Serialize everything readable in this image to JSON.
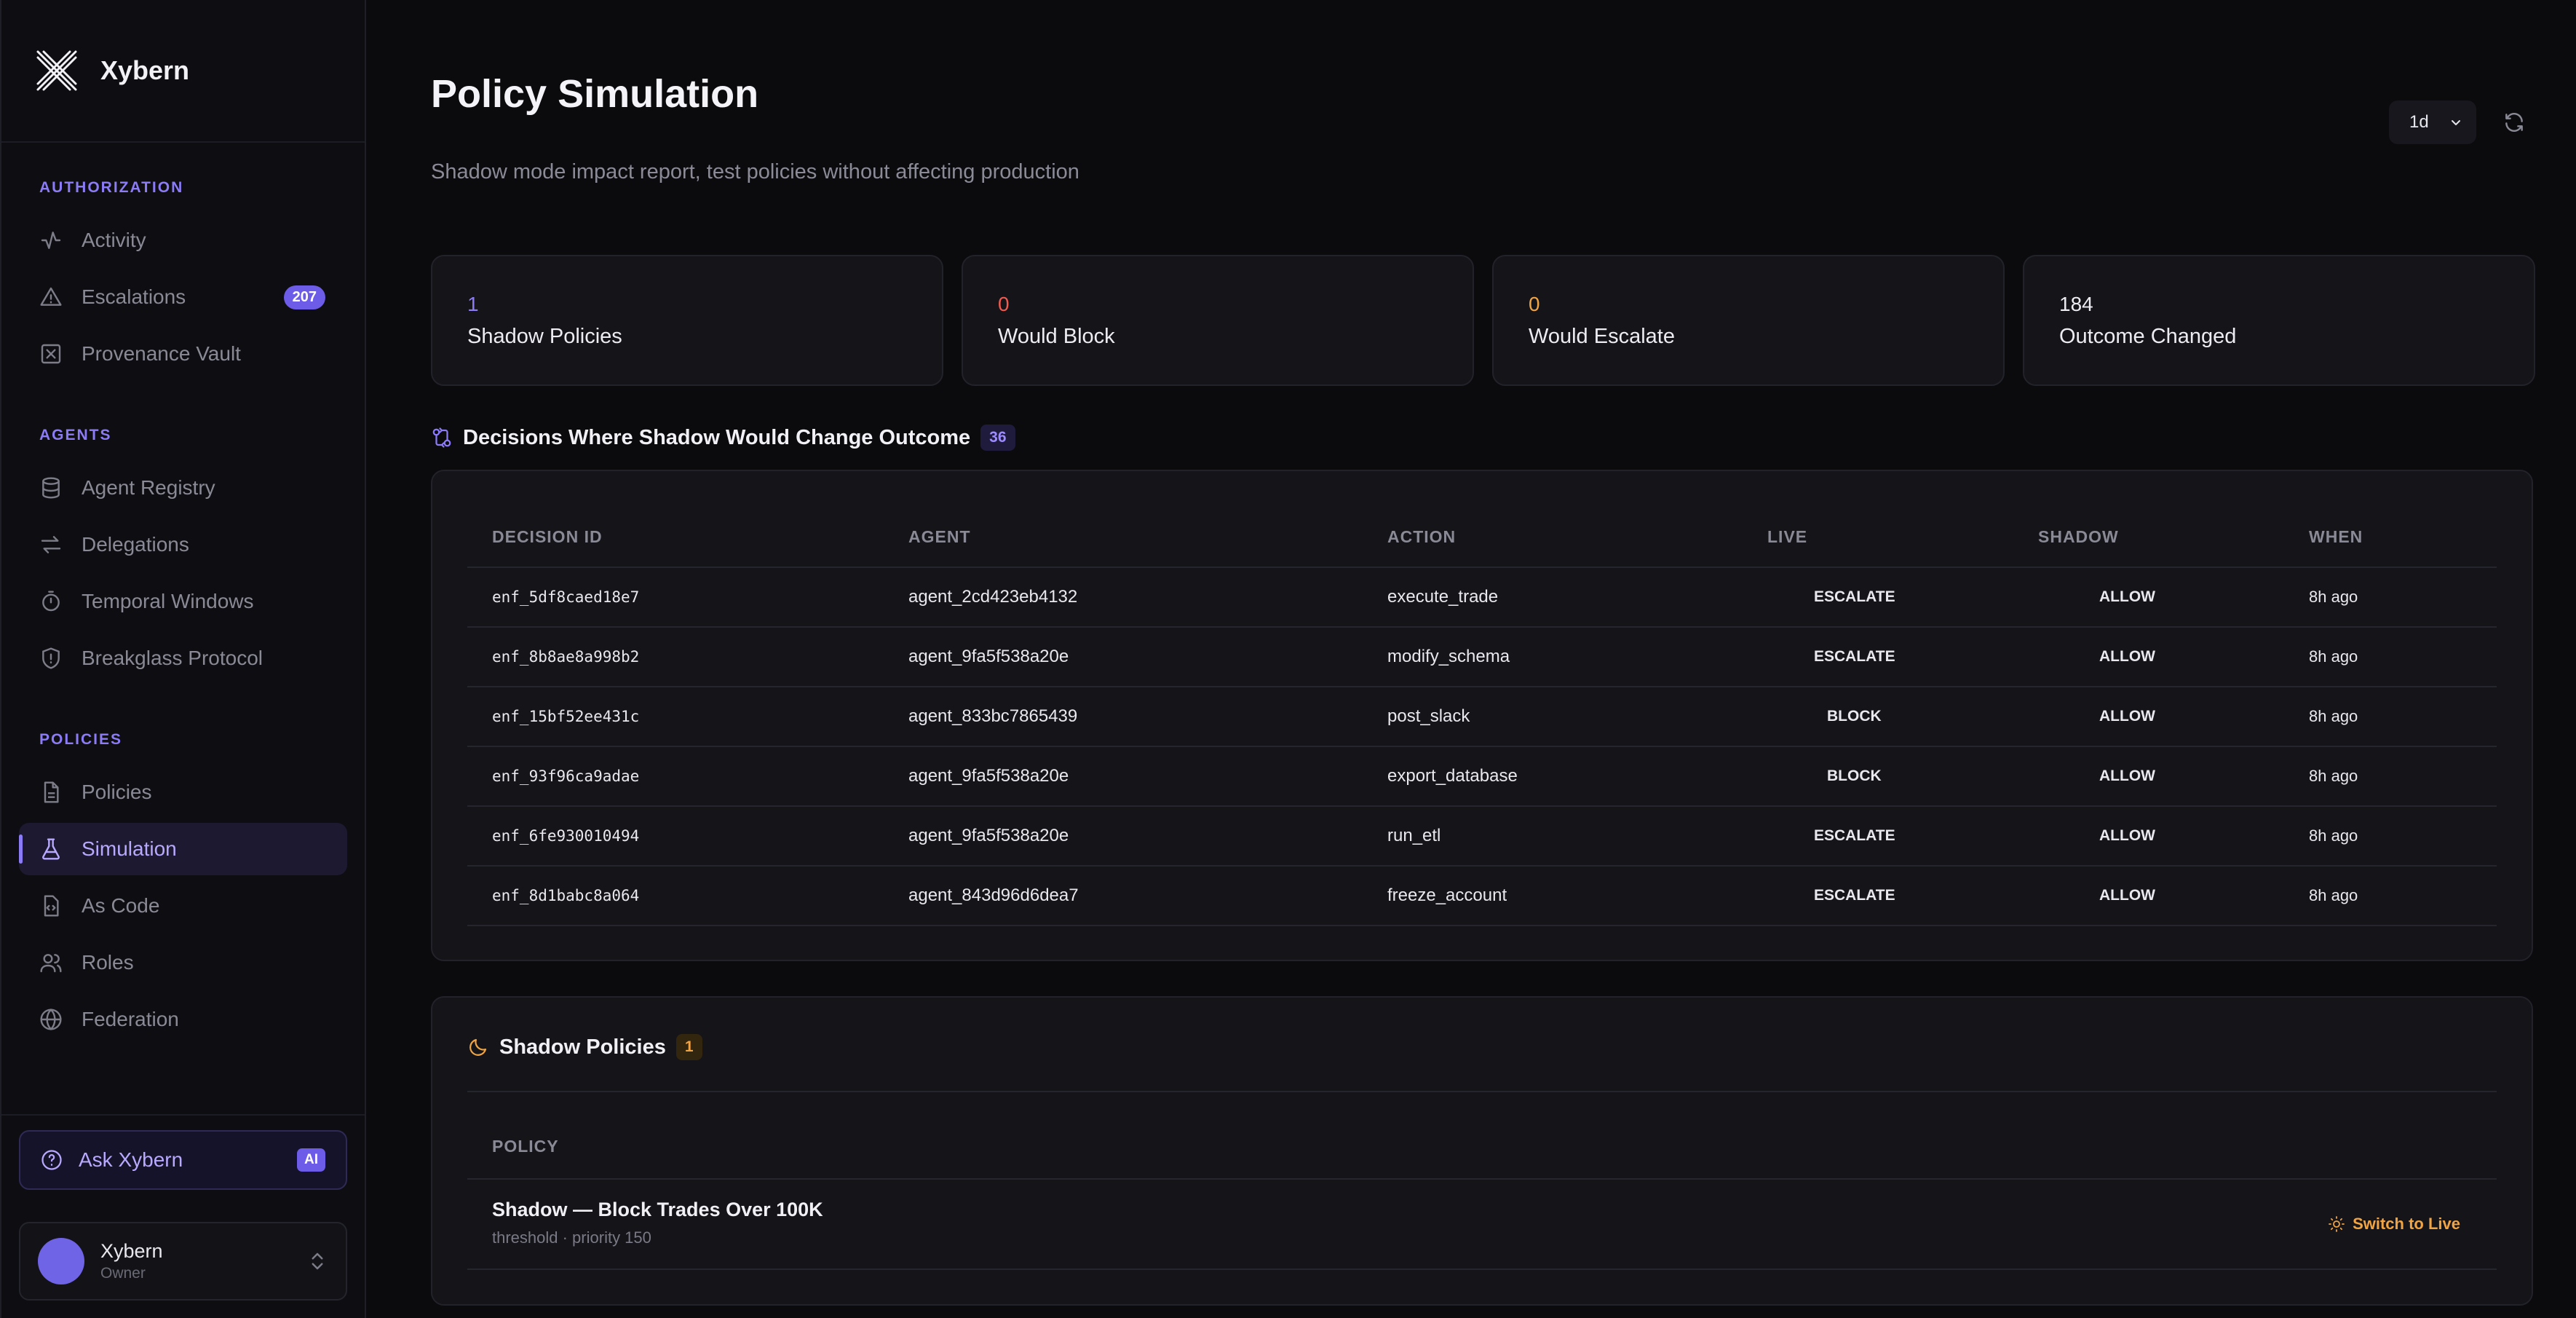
{
  "brand": {
    "name": "Xybern"
  },
  "sidebar": {
    "sections": [
      {
        "label": "AUTHORIZATION",
        "items": [
          {
            "label": "Activity",
            "icon": "activity-icon"
          },
          {
            "label": "Escalations",
            "icon": "warning-triangle-icon",
            "badge": "207"
          },
          {
            "label": "Provenance Vault",
            "icon": "vault-icon"
          }
        ]
      },
      {
        "label": "AGENTS",
        "items": [
          {
            "label": "Agent Registry",
            "icon": "database-icon"
          },
          {
            "label": "Delegations",
            "icon": "arrows-exchange-icon"
          },
          {
            "label": "Temporal Windows",
            "icon": "timer-icon"
          },
          {
            "label": "Breakglass Protocol",
            "icon": "shield-icon"
          }
        ]
      },
      {
        "label": "POLICIES",
        "items": [
          {
            "label": "Policies",
            "icon": "document-icon"
          },
          {
            "label": "Simulation",
            "icon": "flask-icon",
            "active": true
          },
          {
            "label": "As Code",
            "icon": "code-file-icon"
          },
          {
            "label": "Roles",
            "icon": "users-icon"
          },
          {
            "label": "Federation",
            "icon": "globe-icon"
          }
        ]
      }
    ],
    "ask": {
      "label": "Ask Xybern",
      "badge": "AI"
    },
    "user": {
      "name": "Xybern",
      "role": "Owner"
    }
  },
  "header": {
    "title": "Policy Simulation",
    "subtitle": "Shadow mode impact report, test policies without affecting production",
    "range": "1d"
  },
  "stats": [
    {
      "value": "1",
      "label": "Shadow Policies",
      "color": "#8b7cf6"
    },
    {
      "value": "0",
      "label": "Would Block",
      "color": "#f05a4f"
    },
    {
      "value": "0",
      "label": "Would Escalate",
      "color": "#f0a443"
    },
    {
      "value": "184",
      "label": "Outcome Changed",
      "color": "#ececf2"
    }
  ],
  "decisions": {
    "title": "Decisions Where Shadow Would Change Outcome",
    "count": "36",
    "columns": [
      "DECISION ID",
      "AGENT",
      "ACTION",
      "LIVE",
      "SHADOW",
      "WHEN"
    ],
    "rows": [
      {
        "id": "enf_5df8caed18e7",
        "agent": "agent_2cd423eb4132",
        "action": "execute_trade",
        "live": "ESCALATE",
        "shadow": "ALLOW",
        "when": "8h ago"
      },
      {
        "id": "enf_8b8ae8a998b2",
        "agent": "agent_9fa5f538a20e",
        "action": "modify_schema",
        "live": "ESCALATE",
        "shadow": "ALLOW",
        "when": "8h ago"
      },
      {
        "id": "enf_15bf52ee431c",
        "agent": "agent_833bc7865439",
        "action": "post_slack",
        "live": "BLOCK",
        "shadow": "ALLOW",
        "when": "8h ago"
      },
      {
        "id": "enf_93f96ca9adae",
        "agent": "agent_9fa5f538a20e",
        "action": "export_database",
        "live": "BLOCK",
        "shadow": "ALLOW",
        "when": "8h ago"
      },
      {
        "id": "enf_6fe930010494",
        "agent": "agent_9fa5f538a20e",
        "action": "run_etl",
        "live": "ESCALATE",
        "shadow": "ALLOW",
        "when": "8h ago"
      },
      {
        "id": "enf_8d1babc8a064",
        "agent": "agent_843d96d6dea7",
        "action": "freeze_account",
        "live": "ESCALATE",
        "shadow": "ALLOW",
        "when": "8h ago"
      }
    ]
  },
  "shadow_policies": {
    "title": "Shadow Policies",
    "count": "1",
    "column": "POLICY",
    "rows": [
      {
        "name": "Shadow — Block Trades Over 100K",
        "meta": "threshold · priority 150",
        "action": "Switch to Live"
      }
    ]
  }
}
